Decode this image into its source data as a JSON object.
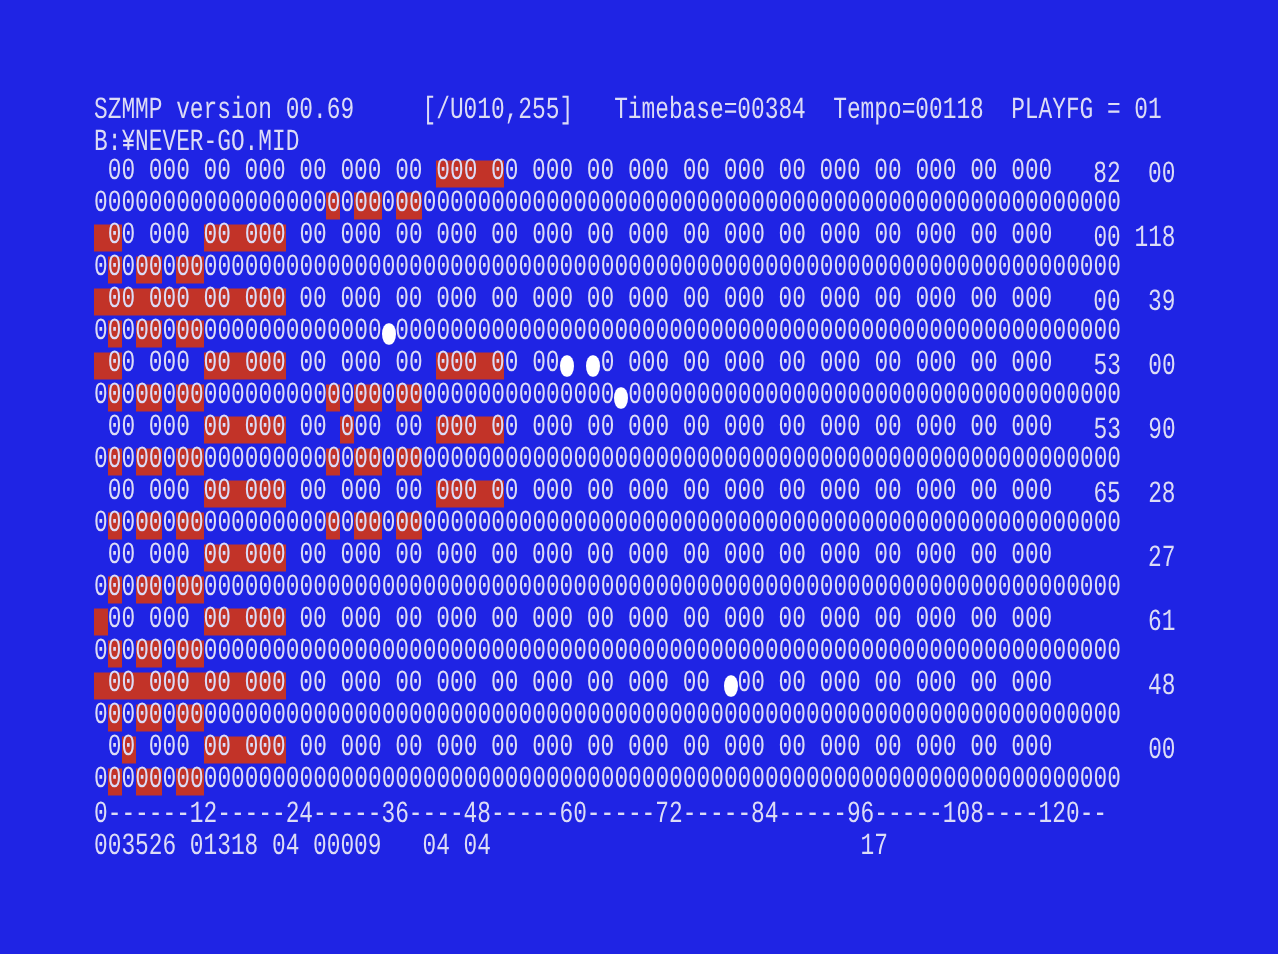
{
  "header": {
    "program": "SZMMP version 00.69",
    "range": "[/U010,255]",
    "timebase": "Timebase=00384",
    "tempo": "Tempo=00118",
    "playfg": "PLAYFG = 01"
  },
  "file": "B:¥NEVER-GO.MID",
  "channels": [
    {
      "black_keys": [
        {
          "kind": "keys",
          "text": " 00 000 00 000 00 000 00 ",
          "pressed": false
        },
        {
          "kind": "keys",
          "text": "000 0",
          "pressed": true
        },
        {
          "kind": "keys",
          "text": "0 000 00 000 00 000 00 000 00 000 00 000",
          "pressed": false
        }
      ],
      "white_keys": [
        {
          "kind": "keys",
          "text": "00000000000000000",
          "pressed": false
        },
        {
          "kind": "keys",
          "text": "0",
          "pressed": true
        },
        {
          "kind": "keys",
          "text": "0",
          "pressed": false
        },
        {
          "kind": "keys",
          "text": "00",
          "pressed": true
        },
        {
          "kind": "keys",
          "text": "0",
          "pressed": false
        },
        {
          "kind": "keys",
          "text": "00",
          "pressed": true
        },
        {
          "kind": "keys",
          "text": "000000000000000000000000000000000000000000000000000",
          "pressed": false
        }
      ],
      "value_1": "82",
      "value_2": "00"
    },
    {
      "black_keys": [
        {
          "kind": "keys",
          "text": " 0",
          "pressed": true
        },
        {
          "kind": "keys",
          "text": "0 000 ",
          "pressed": false
        },
        {
          "kind": "keys",
          "text": "00 000",
          "pressed": true
        },
        {
          "kind": "keys",
          "text": " 00 000 00 000 00 000 00 000 00 000 00 000 00 000 00 000",
          "pressed": false
        }
      ],
      "white_keys": [
        {
          "kind": "keys",
          "text": "0",
          "pressed": false
        },
        {
          "kind": "keys",
          "text": "0",
          "pressed": true
        },
        {
          "kind": "keys",
          "text": "0",
          "pressed": false
        },
        {
          "kind": "keys",
          "text": "00",
          "pressed": true
        },
        {
          "kind": "keys",
          "text": "0",
          "pressed": false
        },
        {
          "kind": "keys",
          "text": "00",
          "pressed": true
        },
        {
          "kind": "keys",
          "text": "0000000000000000000000000000000000000000000000000000000000000000000",
          "pressed": false
        }
      ],
      "value_1": "00",
      "value_2": "118"
    },
    {
      "black_keys": [
        {
          "kind": "keys",
          "text": " 00 000 00 000",
          "pressed": true
        },
        {
          "kind": "keys",
          "text": " 00 000 00 000 00 000 00 000 00 000 00 000 00 000 00 000",
          "pressed": false
        }
      ],
      "white_keys": [
        {
          "kind": "keys",
          "text": "0",
          "pressed": false
        },
        {
          "kind": "keys",
          "text": "0",
          "pressed": true
        },
        {
          "kind": "keys",
          "text": "0",
          "pressed": false
        },
        {
          "kind": "keys",
          "text": "00",
          "pressed": true
        },
        {
          "kind": "keys",
          "text": "0",
          "pressed": false
        },
        {
          "kind": "keys",
          "text": "00",
          "pressed": true
        },
        {
          "kind": "keys",
          "text": "0000000000000",
          "pressed": false
        },
        {
          "kind": "marker"
        },
        {
          "kind": "keys",
          "text": "00000000000000000000000000000000000000000000000000000",
          "pressed": false
        }
      ],
      "value_1": "00",
      "value_2": "39"
    },
    {
      "black_keys": [
        {
          "kind": "keys",
          "text": " 0",
          "pressed": true
        },
        {
          "kind": "keys",
          "text": "0 000 ",
          "pressed": false
        },
        {
          "kind": "keys",
          "text": "00 000",
          "pressed": true
        },
        {
          "kind": "keys",
          "text": " 00 000 00 ",
          "pressed": false
        },
        {
          "kind": "keys",
          "text": "000 0",
          "pressed": true
        },
        {
          "kind": "keys",
          "text": "0 00",
          "pressed": false
        },
        {
          "kind": "marker"
        },
        {
          "kind": "gap"
        },
        {
          "kind": "marker"
        },
        {
          "kind": "keys",
          "text": "0 000 00 000 00 000 00 000 00 000",
          "pressed": false
        }
      ],
      "white_keys": [
        {
          "kind": "keys",
          "text": "0",
          "pressed": false
        },
        {
          "kind": "keys",
          "text": "0",
          "pressed": true
        },
        {
          "kind": "keys",
          "text": "0",
          "pressed": false
        },
        {
          "kind": "keys",
          "text": "00",
          "pressed": true
        },
        {
          "kind": "keys",
          "text": "0",
          "pressed": false
        },
        {
          "kind": "keys",
          "text": "00",
          "pressed": true
        },
        {
          "kind": "keys",
          "text": "000000000",
          "pressed": false
        },
        {
          "kind": "keys",
          "text": "0",
          "pressed": true
        },
        {
          "kind": "keys",
          "text": "0",
          "pressed": false
        },
        {
          "kind": "keys",
          "text": "00",
          "pressed": true
        },
        {
          "kind": "keys",
          "text": "0",
          "pressed": false
        },
        {
          "kind": "keys",
          "text": "00",
          "pressed": true
        },
        {
          "kind": "keys",
          "text": "00000000000000",
          "pressed": false
        },
        {
          "kind": "marker"
        },
        {
          "kind": "keys",
          "text": "000000000000000000000000000000000000",
          "pressed": false
        }
      ],
      "value_1": "53",
      "value_2": "00"
    },
    {
      "black_keys": [
        {
          "kind": "keys",
          "text": " 00 000 ",
          "pressed": false
        },
        {
          "kind": "keys",
          "text": "00 000",
          "pressed": true
        },
        {
          "kind": "keys",
          "text": " 00 ",
          "pressed": false
        },
        {
          "kind": "keys",
          "text": "0",
          "pressed": true
        },
        {
          "kind": "keys",
          "text": "00 00 ",
          "pressed": false
        },
        {
          "kind": "keys",
          "text": "000 0",
          "pressed": true
        },
        {
          "kind": "keys",
          "text": "0 000 00 000 00 000 00 000 00 000 00 000",
          "pressed": false
        }
      ],
      "white_keys": [
        {
          "kind": "keys",
          "text": "0",
          "pressed": false
        },
        {
          "kind": "keys",
          "text": "0",
          "pressed": true
        },
        {
          "kind": "keys",
          "text": "0",
          "pressed": false
        },
        {
          "kind": "keys",
          "text": "00",
          "pressed": true
        },
        {
          "kind": "keys",
          "text": "0",
          "pressed": false
        },
        {
          "kind": "keys",
          "text": "00",
          "pressed": true
        },
        {
          "kind": "keys",
          "text": "000000000",
          "pressed": false
        },
        {
          "kind": "keys",
          "text": "0",
          "pressed": true
        },
        {
          "kind": "keys",
          "text": "0",
          "pressed": false
        },
        {
          "kind": "keys",
          "text": "00",
          "pressed": true
        },
        {
          "kind": "keys",
          "text": "0",
          "pressed": false
        },
        {
          "kind": "keys",
          "text": "00",
          "pressed": true
        },
        {
          "kind": "keys",
          "text": "000000000000000000000000000000000000000000000000000",
          "pressed": false
        }
      ],
      "value_1": "53",
      "value_2": "90"
    },
    {
      "black_keys": [
        {
          "kind": "keys",
          "text": " 00 000 ",
          "pressed": false
        },
        {
          "kind": "keys",
          "text": "00 000",
          "pressed": true
        },
        {
          "kind": "keys",
          "text": " 00 000 00 ",
          "pressed": false
        },
        {
          "kind": "keys",
          "text": "000 0",
          "pressed": true
        },
        {
          "kind": "keys",
          "text": "0 000 00 000 00 000 00 000 00 000 00 000",
          "pressed": false
        }
      ],
      "white_keys": [
        {
          "kind": "keys",
          "text": "0",
          "pressed": false
        },
        {
          "kind": "keys",
          "text": "0",
          "pressed": true
        },
        {
          "kind": "keys",
          "text": "0",
          "pressed": false
        },
        {
          "kind": "keys",
          "text": "00",
          "pressed": true
        },
        {
          "kind": "keys",
          "text": "0",
          "pressed": false
        },
        {
          "kind": "keys",
          "text": "00",
          "pressed": true
        },
        {
          "kind": "keys",
          "text": "000000000",
          "pressed": false
        },
        {
          "kind": "keys",
          "text": "0",
          "pressed": true
        },
        {
          "kind": "keys",
          "text": "0",
          "pressed": false
        },
        {
          "kind": "keys",
          "text": "00",
          "pressed": true
        },
        {
          "kind": "keys",
          "text": "0",
          "pressed": false
        },
        {
          "kind": "keys",
          "text": "00",
          "pressed": true
        },
        {
          "kind": "keys",
          "text": "000000000000000000000000000000000000000000000000000",
          "pressed": false
        }
      ],
      "value_1": "65",
      "value_2": "28"
    },
    {
      "black_keys": [
        {
          "kind": "keys",
          "text": " 00 000 ",
          "pressed": false
        },
        {
          "kind": "keys",
          "text": "00 000",
          "pressed": true
        },
        {
          "kind": "keys",
          "text": " 00 000 00 000 00 000 00 000 00 000 00 000 00 000 00 000",
          "pressed": false
        }
      ],
      "white_keys": [
        {
          "kind": "keys",
          "text": "0",
          "pressed": false
        },
        {
          "kind": "keys",
          "text": "0",
          "pressed": true
        },
        {
          "kind": "keys",
          "text": "0",
          "pressed": false
        },
        {
          "kind": "keys",
          "text": "00",
          "pressed": true
        },
        {
          "kind": "keys",
          "text": "0",
          "pressed": false
        },
        {
          "kind": "keys",
          "text": "00",
          "pressed": true
        },
        {
          "kind": "keys",
          "text": "0000000000000000000000000000000000000000000000000000000000000000000",
          "pressed": false
        }
      ],
      "value_2": "27"
    },
    {
      "black_keys": [
        {
          "kind": "gap",
          "pressed": true
        },
        {
          "kind": "keys",
          "text": "00 000 ",
          "pressed": false
        },
        {
          "kind": "keys",
          "text": "00 000",
          "pressed": true
        },
        {
          "kind": "keys",
          "text": " 00 000 00 000 00 000 00 000 00 000 00 000 00 000 00 000",
          "pressed": false
        }
      ],
      "white_keys": [
        {
          "kind": "keys",
          "text": "0",
          "pressed": false
        },
        {
          "kind": "keys",
          "text": "0",
          "pressed": true
        },
        {
          "kind": "keys",
          "text": "0",
          "pressed": false
        },
        {
          "kind": "keys",
          "text": "00",
          "pressed": true
        },
        {
          "kind": "keys",
          "text": "0",
          "pressed": false
        },
        {
          "kind": "keys",
          "text": "00",
          "pressed": true
        },
        {
          "kind": "keys",
          "text": "0000000000000000000000000000000000000000000000000000000000000000000",
          "pressed": false
        }
      ],
      "value_2": "61"
    },
    {
      "black_keys": [
        {
          "kind": "keys",
          "text": " 00 000 00 000",
          "pressed": true
        },
        {
          "kind": "keys",
          "text": " 00 000 00 000 00 000 00 000 00 ",
          "pressed": false
        },
        {
          "kind": "marker"
        },
        {
          "kind": "keys",
          "text": "00 00 000 00 000 00 000",
          "pressed": false
        }
      ],
      "white_keys": [
        {
          "kind": "keys",
          "text": "0",
          "pressed": false
        },
        {
          "kind": "keys",
          "text": "0",
          "pressed": true
        },
        {
          "kind": "keys",
          "text": "0",
          "pressed": false
        },
        {
          "kind": "keys",
          "text": "00",
          "pressed": true
        },
        {
          "kind": "keys",
          "text": "0",
          "pressed": false
        },
        {
          "kind": "keys",
          "text": "00",
          "pressed": true
        },
        {
          "kind": "keys",
          "text": "0000000000000000000000000000000000000000000000000000000000000000000",
          "pressed": false
        }
      ],
      "value_2": "48"
    },
    {
      "black_keys": [
        {
          "kind": "keys",
          "text": " 0",
          "pressed": false
        },
        {
          "kind": "keys",
          "text": "0",
          "pressed": true
        },
        {
          "kind": "keys",
          "text": " 000 ",
          "pressed": false
        },
        {
          "kind": "keys",
          "text": "00 000",
          "pressed": true
        },
        {
          "kind": "keys",
          "text": " 00 000 00 000 00 000 00 000 00 000 00 000 00 000 00 000",
          "pressed": false
        }
      ],
      "white_keys": [
        {
          "kind": "keys",
          "text": "0",
          "pressed": false
        },
        {
          "kind": "keys",
          "text": "0",
          "pressed": true
        },
        {
          "kind": "keys",
          "text": "0",
          "pressed": false
        },
        {
          "kind": "keys",
          "text": "00",
          "pressed": true
        },
        {
          "kind": "keys",
          "text": "0",
          "pressed": false
        },
        {
          "kind": "keys",
          "text": "00",
          "pressed": true
        },
        {
          "kind": "keys",
          "text": "0000000000000000000000000000000000000000000000000000000000000000000",
          "pressed": false
        }
      ],
      "value_2": "00"
    }
  ],
  "ruler": "0------12-----24-----36----48-----60-----72-----84-----96-----108----120--",
  "status": {
    "counters": "003526 01318 04 00009   04 04",
    "value": "17"
  }
}
